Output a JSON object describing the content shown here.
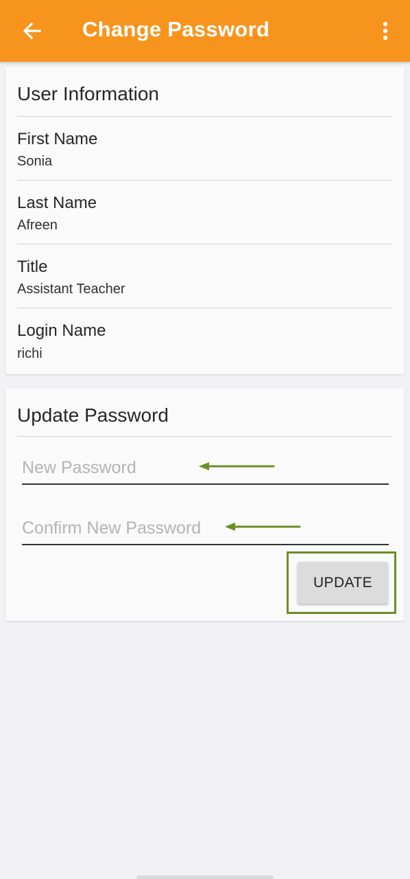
{
  "appbar": {
    "title": "Change Password",
    "back_icon": "arrow-left-icon",
    "menu_icon": "more-vertical-icon",
    "color": "#f7941d"
  },
  "user_info": {
    "title": "User Information",
    "fields": [
      {
        "label": "First Name",
        "value": "Sonia"
      },
      {
        "label": "Last Name",
        "value": "Afreen"
      },
      {
        "label": "Title",
        "value": "Assistant Teacher"
      },
      {
        "label": "Login Name",
        "value": "richi"
      }
    ]
  },
  "update_password": {
    "title": "Update Password",
    "new_password": {
      "placeholder": "New Password",
      "value": ""
    },
    "confirm_password": {
      "placeholder": "Confirm New Password",
      "value": ""
    },
    "update_label": "UPDATE"
  },
  "annotation": {
    "color": "#6b8e23",
    "arrow_icon": "annotation-arrow-left-icon"
  }
}
